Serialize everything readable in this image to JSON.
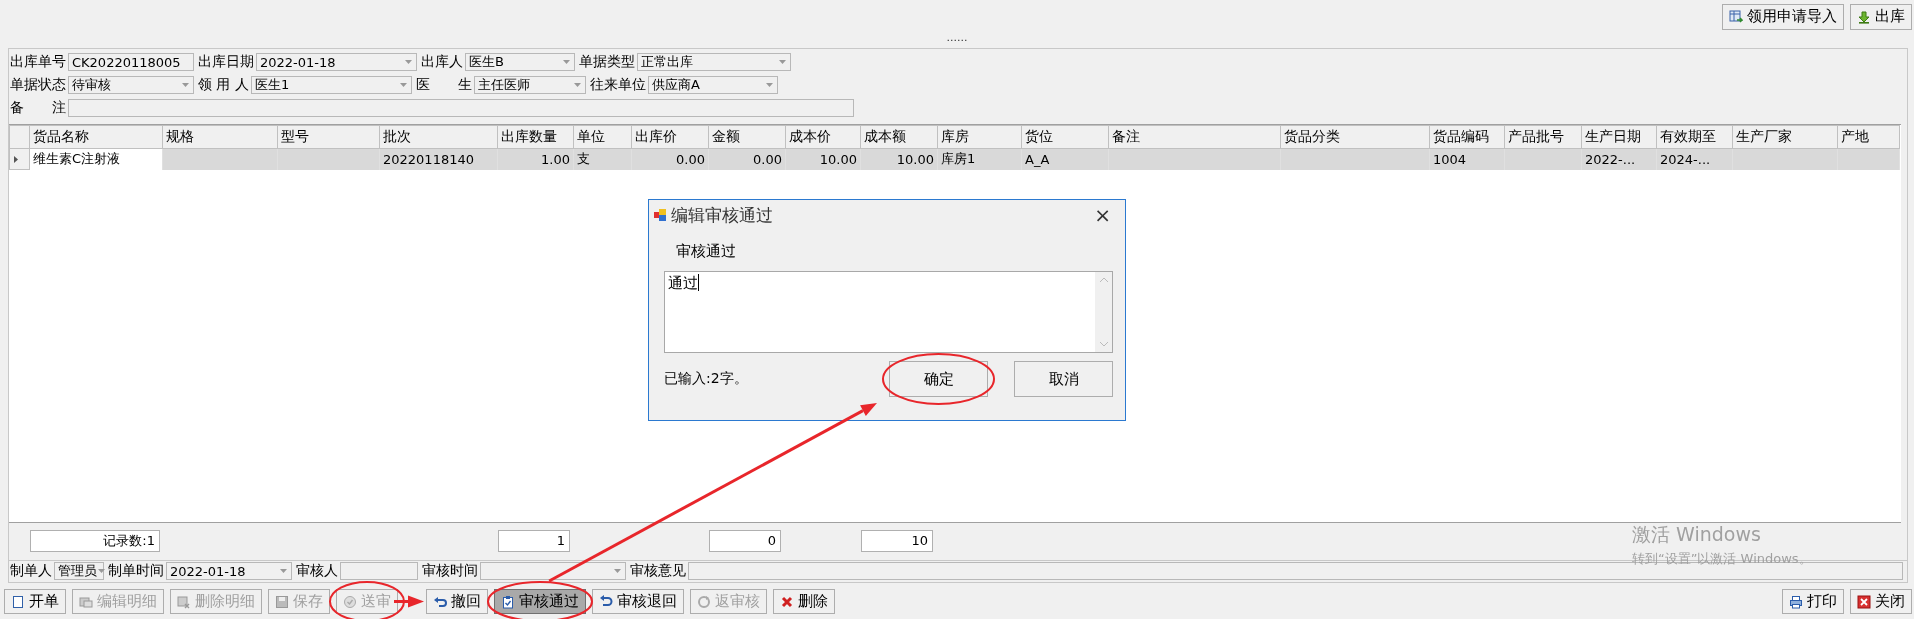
{
  "top_toolbar": [
    {
      "label": "领用申请导入"
    },
    {
      "label": "出库"
    }
  ],
  "splitter": "......",
  "form": {
    "rows": [
      [
        {
          "label": "出库单号",
          "value": "CK20220118005",
          "kind": "text"
        },
        {
          "label": "出库日期",
          "value": "2022-01-18",
          "kind": "combo"
        },
        {
          "label": "出库人",
          "value": "医生B",
          "kind": "combo"
        },
        {
          "label": "单据类型",
          "value": "正常出库",
          "kind": "combo"
        }
      ],
      [
        {
          "label": "单据状态",
          "value": "待审核",
          "kind": "combo"
        },
        {
          "label": "领 用 人",
          "value": "医生1",
          "kind": "combo"
        },
        {
          "label": "医　　生",
          "value": "主任医师",
          "kind": "combo"
        },
        {
          "label": "往来单位",
          "value": "供应商A",
          "kind": "combo"
        }
      ],
      [
        {
          "label": "备　　注",
          "kind": "text"
        }
      ]
    ]
  },
  "table": {
    "columns": [
      {
        "label": "货品名称",
        "kind": "text",
        "total": "记录数:1"
      },
      {
        "label": "规格",
        "kind": "text"
      },
      {
        "label": "型号",
        "kind": "text"
      },
      {
        "label": "批次",
        "kind": "text"
      },
      {
        "label": "出库数量",
        "kind": "number",
        "total": "1"
      },
      {
        "label": "单位",
        "kind": "text"
      },
      {
        "label": "出库价",
        "kind": "number"
      },
      {
        "label": "金额",
        "kind": "number",
        "total": "0"
      },
      {
        "label": "成本价",
        "kind": "number"
      },
      {
        "label": "成本额",
        "kind": "number",
        "total": "10"
      },
      {
        "label": "库房",
        "kind": "text"
      },
      {
        "label": "货位",
        "kind": "text"
      },
      {
        "label": "备注",
        "kind": "text"
      },
      {
        "label": "货品分类",
        "kind": "text"
      },
      {
        "label": "货品编码",
        "kind": "text"
      },
      {
        "label": "产品批号",
        "kind": "text"
      },
      {
        "label": "生产日期",
        "kind": "text"
      },
      {
        "label": "有效期至",
        "kind": "text"
      },
      {
        "label": "生产厂家",
        "kind": "text"
      },
      {
        "label": "产地",
        "kind": "text"
      }
    ],
    "rows": [
      {
        "selected": true,
        "cells": [
          "维生素C注射液",
          "",
          "",
          "20220118140",
          "1.00",
          "支",
          "0.00",
          "0.00",
          "10.00",
          "10.00",
          "库房1",
          "A_A",
          "",
          "",
          "1004",
          "",
          "2022-...",
          "2024-...",
          "",
          ""
        ]
      }
    ]
  },
  "info_row": [
    {
      "label": "制单人",
      "value": "管理员",
      "kind": "combo"
    },
    {
      "label": "制单时间",
      "value": "2022-01-18",
      "kind": "combo"
    },
    {
      "label": "审核人",
      "kind": "text"
    },
    {
      "label": "审核时间",
      "kind": "combo"
    },
    {
      "label": "审核意见",
      "kind": "text"
    }
  ],
  "toolbar": [
    {
      "label": "开单",
      "disabled": false,
      "selected": false
    },
    {
      "label": "编辑明细",
      "disabled": true,
      "selected": false
    },
    {
      "label": "删除明细",
      "disabled": true,
      "selected": false
    },
    {
      "label": "保存",
      "disabled": true,
      "selected": false
    },
    {
      "label": "送审",
      "disabled": true,
      "selected": false,
      "circled": true,
      "arrow": true
    },
    {
      "label": "撤回",
      "disabled": false,
      "selected": false
    },
    {
      "label": "审核通过",
      "disabled": false,
      "selected": true,
      "circled": true,
      "arrow": true
    },
    {
      "label": "审核退回",
      "disabled": false,
      "selected": false
    },
    {
      "label": "返审核",
      "disabled": true,
      "selected": false
    },
    {
      "label": "删除",
      "disabled": false,
      "selected": false
    }
  ],
  "toolbar_right": [
    {
      "label": "打印"
    },
    {
      "label": "关闭"
    }
  ],
  "watermark": [
    "激活 Windows",
    "转到“设置”以激活 Windows。"
  ],
  "dialog": {
    "title": "编辑审核通过",
    "close": "×",
    "label": "审核通过",
    "value": "通过",
    "counter": "已输入:2字。",
    "buttons": [
      {
        "label": "确定",
        "circled": true
      },
      {
        "label": "取消"
      }
    ]
  }
}
